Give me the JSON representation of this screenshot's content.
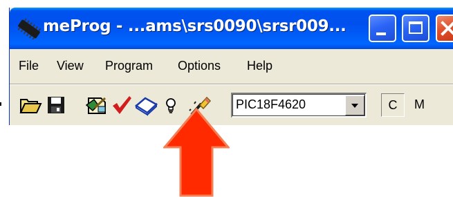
{
  "window": {
    "title": "meProg - ...ams\\srs0090\\srsr009...",
    "buttons": {
      "minimize": "minimize-icon",
      "maximize": "maximize-icon",
      "close": "close-icon"
    }
  },
  "menu": {
    "file": "File",
    "view": "View",
    "program": "Program",
    "options": "Options",
    "help": "Help"
  },
  "toolbar": {
    "icons": [
      "open-folder-icon",
      "save-icon",
      "read-chip-icon",
      "verify-check-icon",
      "erase-icon",
      "lightbulb-icon",
      "program-wand-icon"
    ],
    "device_select": "PIC18F4620",
    "mode_box": "C",
    "mode_label": "M"
  },
  "annotation": {
    "arrow_color": "#ff2a00",
    "arrow_outline": "#f57f55"
  },
  "colors": {
    "titlebar": "#0050ee",
    "face": "#ece9d8",
    "close": "#e0502a"
  }
}
